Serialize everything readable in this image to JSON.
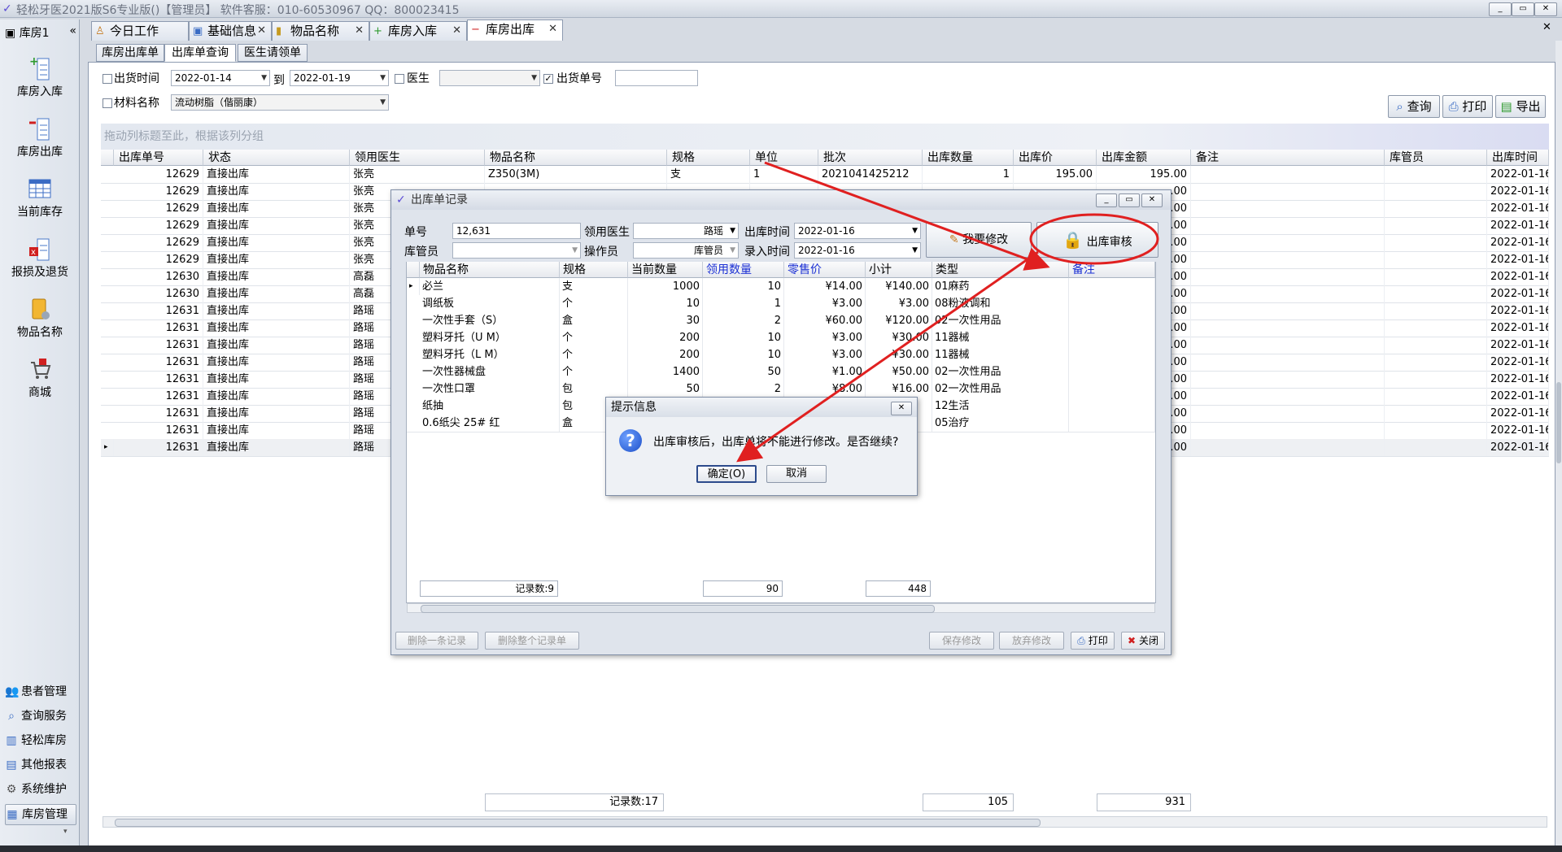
{
  "app": {
    "title": "轻松牙医2021版S6专业版()【管理员】    软件客服：010-60530967  QQ：800023415",
    "window_controls": [
      "_",
      "▭",
      "✕"
    ]
  },
  "sidebar": {
    "header": "库房1",
    "collapse": "«",
    "items": [
      {
        "label": "库房入库",
        "icon": "stock-in-icon"
      },
      {
        "label": "库房出库",
        "icon": "stock-out-icon"
      },
      {
        "label": "当前库存",
        "icon": "inventory-grid-icon"
      },
      {
        "label": "报损及退货",
        "icon": "damage-return-icon"
      },
      {
        "label": "物品名称",
        "icon": "item-name-icon"
      },
      {
        "label": "商城",
        "icon": "shop-cart-icon"
      }
    ],
    "modules": [
      {
        "label": "患者管理",
        "icon": "patients-icon"
      },
      {
        "label": "查询服务",
        "icon": "query-icon"
      },
      {
        "label": "轻松库房",
        "icon": "warehouse-icon"
      },
      {
        "label": "其他报表",
        "icon": "report-icon"
      },
      {
        "label": "系统维护",
        "icon": "maintenance-icon"
      },
      {
        "label": "库房管理",
        "icon": "storage-manage-icon"
      }
    ]
  },
  "tabs": [
    {
      "label": "今日工作",
      "icon": "today-icon"
    },
    {
      "label": "基础信息",
      "icon": "basic-info-icon"
    },
    {
      "label": "物品名称",
      "icon": "item-icon"
    },
    {
      "label": "库房入库",
      "icon": "stock-in-icon"
    },
    {
      "label": "库房出库",
      "icon": "stock-out-icon"
    }
  ],
  "tab_close": "✕",
  "subtabs": [
    "库房出库单",
    "出库单查询",
    "医生请领单"
  ],
  "filters": {
    "ship_time_label": "出货时间",
    "date_from": "2022-01-14",
    "to_label": "到",
    "date_to": "2022-01-19",
    "doctor_label": "医生",
    "doctor_value": "",
    "order_no_label": "出货单号",
    "order_no_checked": "✓",
    "order_no_value": "",
    "material_label": "材料名称",
    "material_value": "流动树脂（偕丽康）"
  },
  "toolbar": {
    "query": "查询",
    "print": "打印",
    "export": "导出"
  },
  "grid": {
    "group_hint": "拖动列标题至此，根据该列分组",
    "columns": [
      "出库单号",
      "状态",
      "领用医生",
      "物品名称",
      "规格",
      "单位",
      "批次",
      "出库数量",
      "出库价",
      "出库金额",
      "备注",
      "库管员",
      "出库时间"
    ],
    "rows": [
      {
        "no": "12629",
        "status": "直接出库",
        "doctor": "张亮",
        "item": "Z350(3M)",
        "spec": "支",
        "unit": "1",
        "batch": "2021041425212",
        "qty": "1",
        "price": "195.00",
        "amount": "195.00",
        "time": "2022-01-16"
      },
      {
        "no": "12629",
        "status": "直接出库",
        "doctor": "张亮",
        "item": "",
        "spec": "",
        "unit": "",
        "batch": "",
        "qty": "",
        "price": "",
        "amount": ".00",
        "time": "2022-01-16"
      },
      {
        "no": "12629",
        "status": "直接出库",
        "doctor": "张亮",
        "item": "",
        "spec": "",
        "unit": "",
        "batch": "",
        "qty": "",
        "price": "",
        "amount": ".00",
        "time": "2022-01-16"
      },
      {
        "no": "12629",
        "status": "直接出库",
        "doctor": "张亮",
        "item": "",
        "spec": "",
        "unit": "",
        "batch": "",
        "qty": "",
        "price": "",
        "amount": ".00",
        "time": "2022-01-16"
      },
      {
        "no": "12629",
        "status": "直接出库",
        "doctor": "张亮",
        "item": "",
        "spec": "",
        "unit": "",
        "batch": "",
        "qty": "",
        "price": "",
        "amount": ".00",
        "time": "2022-01-16"
      },
      {
        "no": "12629",
        "status": "直接出库",
        "doctor": "张亮",
        "item": "",
        "spec": "",
        "unit": "",
        "batch": "",
        "qty": "",
        "price": "",
        "amount": ".00",
        "time": "2022-01-16"
      },
      {
        "no": "12630",
        "status": "直接出库",
        "doctor": "高磊",
        "item": "",
        "spec": "",
        "unit": "",
        "batch": "",
        "qty": "",
        "price": "",
        "amount": ".00",
        "time": "2022-01-16"
      },
      {
        "no": "12630",
        "status": "直接出库",
        "doctor": "高磊",
        "item": "",
        "spec": "",
        "unit": "",
        "batch": "",
        "qty": "",
        "price": "",
        "amount": ".00",
        "time": "2022-01-16"
      },
      {
        "no": "12631",
        "status": "直接出库",
        "doctor": "路瑶",
        "item": "",
        "spec": "",
        "unit": "",
        "batch": "",
        "qty": "",
        "price": "",
        "amount": ".00",
        "time": "2022-01-16"
      },
      {
        "no": "12631",
        "status": "直接出库",
        "doctor": "路瑶",
        "item": "",
        "spec": "",
        "unit": "",
        "batch": "",
        "qty": "",
        "price": "",
        "amount": ".00",
        "time": "2022-01-16"
      },
      {
        "no": "12631",
        "status": "直接出库",
        "doctor": "路瑶",
        "item": "",
        "spec": "",
        "unit": "",
        "batch": "",
        "qty": "",
        "price": "",
        "amount": ".00",
        "time": "2022-01-16"
      },
      {
        "no": "12631",
        "status": "直接出库",
        "doctor": "路瑶",
        "item": "",
        "spec": "",
        "unit": "",
        "batch": "",
        "qty": "",
        "price": "",
        "amount": ".00",
        "time": "2022-01-16"
      },
      {
        "no": "12631",
        "status": "直接出库",
        "doctor": "路瑶",
        "item": "",
        "spec": "",
        "unit": "",
        "batch": "",
        "qty": "",
        "price": "",
        "amount": ".00",
        "time": "2022-01-16"
      },
      {
        "no": "12631",
        "status": "直接出库",
        "doctor": "路瑶",
        "item": "",
        "spec": "",
        "unit": "",
        "batch": "",
        "qty": "",
        "price": "",
        "amount": ".00",
        "time": "2022-01-16"
      },
      {
        "no": "12631",
        "status": "直接出库",
        "doctor": "路瑶",
        "item": "",
        "spec": "",
        "unit": "",
        "batch": "",
        "qty": "",
        "price": "",
        "amount": ".00",
        "time": "2022-01-16"
      },
      {
        "no": "12631",
        "status": "直接出库",
        "doctor": "路瑶",
        "item": "",
        "spec": "",
        "unit": "",
        "batch": "",
        "qty": "",
        "price": "",
        "amount": ".00",
        "time": "2022-01-16"
      },
      {
        "no": "12631",
        "status": "直接出库",
        "doctor": "路瑶",
        "item": "",
        "spec": "",
        "unit": "",
        "batch": "",
        "qty": "",
        "price": "",
        "amount": ".00",
        "time": "2022-01-16"
      }
    ],
    "footer": {
      "count": "记录数:17",
      "qty_total": "105",
      "amount_total": "931"
    }
  },
  "record_dialog": {
    "title": "出库单记录",
    "order_no_label": "单号",
    "order_no": "12,631",
    "doctor_label": "领用医生",
    "doctor": "路瑶",
    "out_time_label": "出库时间",
    "out_time": "2022-01-16",
    "keeper_label": "库管员",
    "keeper": "",
    "operator_label": "操作员",
    "operator": "库管员",
    "entry_time_label": "录入时间",
    "entry_time": "2022-01-16",
    "modify_btn": "我要修改",
    "audit_btn": "出库审核",
    "columns": [
      "物品名称",
      "规格",
      "当前数量",
      "领用数量",
      "零售价",
      "小计",
      "类型",
      "备注"
    ],
    "rows": [
      {
        "name": "必兰",
        "spec": "支",
        "cur": "1000",
        "qty": "10",
        "price": "¥14.00",
        "sub": "¥140.00",
        "type": "01麻药"
      },
      {
        "name": "调纸板",
        "spec": "个",
        "cur": "10",
        "qty": "1",
        "price": "¥3.00",
        "sub": "¥3.00",
        "type": "08粉液调和"
      },
      {
        "name": "一次性手套（S）",
        "spec": "盒",
        "cur": "30",
        "qty": "2",
        "price": "¥60.00",
        "sub": "¥120.00",
        "type": "02一次性用品"
      },
      {
        "name": "塑料牙托（U M）",
        "spec": "个",
        "cur": "200",
        "qty": "10",
        "price": "¥3.00",
        "sub": "¥30.00",
        "type": "11器械"
      },
      {
        "name": "塑料牙托（L M）",
        "spec": "个",
        "cur": "200",
        "qty": "10",
        "price": "¥3.00",
        "sub": "¥30.00",
        "type": "11器械"
      },
      {
        "name": "一次性器械盘",
        "spec": "个",
        "cur": "1400",
        "qty": "50",
        "price": "¥1.00",
        "sub": "¥50.00",
        "type": "02一次性用品"
      },
      {
        "name": "一次性口罩",
        "spec": "包",
        "cur": "50",
        "qty": "2",
        "price": "¥8.00",
        "sub": "¥16.00",
        "type": "02一次性用品"
      },
      {
        "name": "纸抽",
        "spec": "包",
        "cur": "",
        "qty": "",
        "price": "",
        "sub": "",
        "type": "12生活"
      },
      {
        "name": "0.6纸尖 25# 红",
        "spec": "盒",
        "cur": "",
        "qty": "",
        "price": "",
        "sub": "",
        "type": "05治疗"
      }
    ],
    "footer": {
      "count": "记录数:9",
      "qty_total": "90",
      "sub_total": "448"
    },
    "buttons": {
      "delete_one": "删除一条记录",
      "delete_all": "删除整个记录单",
      "save": "保存修改",
      "discard": "放弃修改",
      "print": "打印",
      "close": "关闭"
    }
  },
  "confirm_dialog": {
    "title": "提示信息",
    "message": "出库审核后，出库单将不能进行修改。是否继续?",
    "ok": "确定(O)",
    "cancel": "取消",
    "close": "✕"
  },
  "colors": {
    "annotation_red": "#e02020",
    "header_blue": "#1a2fd4"
  }
}
